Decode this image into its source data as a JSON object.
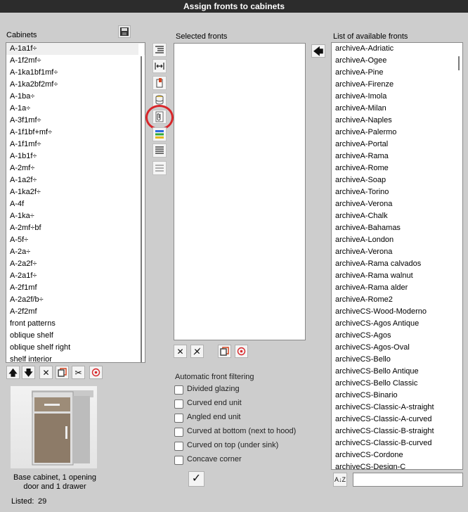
{
  "title": "Assign fronts to cabinets",
  "cabinets": {
    "label": "Cabinets",
    "items": [
      "A-1a1f÷",
      "A-1f2mf÷",
      "A-1ka1bf1mf÷",
      "A-1ka2bf2mf÷",
      "A-1ba÷",
      "A-1a÷",
      "A-3f1mf÷",
      "A-1f1bf+mf÷",
      "A-1f1mf÷",
      "A-1b1f÷",
      "A-2mf÷",
      "A-1a2f÷",
      "A-1ka2f÷",
      "A-4f",
      "A-1ka÷",
      "A-2mf÷bf",
      "A-5f÷",
      "A-2a÷",
      "A-2a2f÷",
      "A-2a1f÷",
      "A-2f1mf",
      "A-2a2f/b÷",
      "A-2f2mf",
      "front patterns",
      "oblique shelf",
      "oblique shelf right",
      "shelf interior"
    ],
    "selected_index": 0,
    "preview_caption": "Base cabinet, 1 opening door and 1 drawer",
    "listed_label": "Listed:",
    "listed_count": "29"
  },
  "selected_fronts": {
    "label": "Selected fronts"
  },
  "filtering": {
    "label": "Automatic front filtering",
    "options": [
      {
        "label": "Divided glazing",
        "checked": false
      },
      {
        "label": "Curved end unit",
        "checked": false
      },
      {
        "label": "Angled end unit",
        "checked": false
      },
      {
        "label": "Curved at bottom (next to hood)",
        "checked": false
      },
      {
        "label": "Curved on top (under sink)",
        "checked": false
      },
      {
        "label": "Concave corner",
        "checked": false
      }
    ],
    "confirm_glyph": "✓"
  },
  "available_fronts": {
    "label": "List of available fronts",
    "items": [
      "archiveA-Adriatic",
      "archiveA-Ogee",
      "archiveA-Pine",
      "archiveA-Firenze",
      "archiveA-Imola",
      "archiveA-Milan",
      "archiveA-Naples",
      "archiveA-Palermo",
      "archiveA-Portal",
      "archiveA-Rama",
      "archiveA-Rome",
      "archiveA-Soap",
      "archiveA-Torino",
      "archiveA-Verona",
      "archiveA-Chalk",
      "archiveA-Bahamas",
      "archiveA-London",
      "archiveA-Verona",
      "archiveA-Rama calvados",
      "archiveA-Rama walnut",
      "archiveA-Rama alder",
      "archiveA-Rome2",
      "archiveCS-Wood-Moderno",
      "archiveCS-Agos Antique",
      "archiveCS-Agos",
      "archiveCS-Agos-Oval",
      "archiveCS-Bello",
      "archiveCS-Bello Antique",
      "archiveCS-Bello Classic",
      "archiveCS-Binario",
      "archiveCS-Classic-A-straight",
      "archiveCS-Classic-A-curved",
      "archiveCS-Classic-B-straight",
      "archiveCS-Classic-B-curved",
      "archiveCS-Cordone",
      "archiveCS-Design-C"
    ],
    "search_value": ""
  },
  "icons": {
    "save": "save-icon",
    "move_up": "arrow-up-icon",
    "move_down": "arrow-down-icon",
    "delete": "delete-icon",
    "copy": "copy-icon",
    "cut": "scissors-icon",
    "target": "target-icon",
    "add_front": "arrow-left-icon",
    "sort": "sort-az-icon",
    "highlight_color": "#d8262a"
  }
}
